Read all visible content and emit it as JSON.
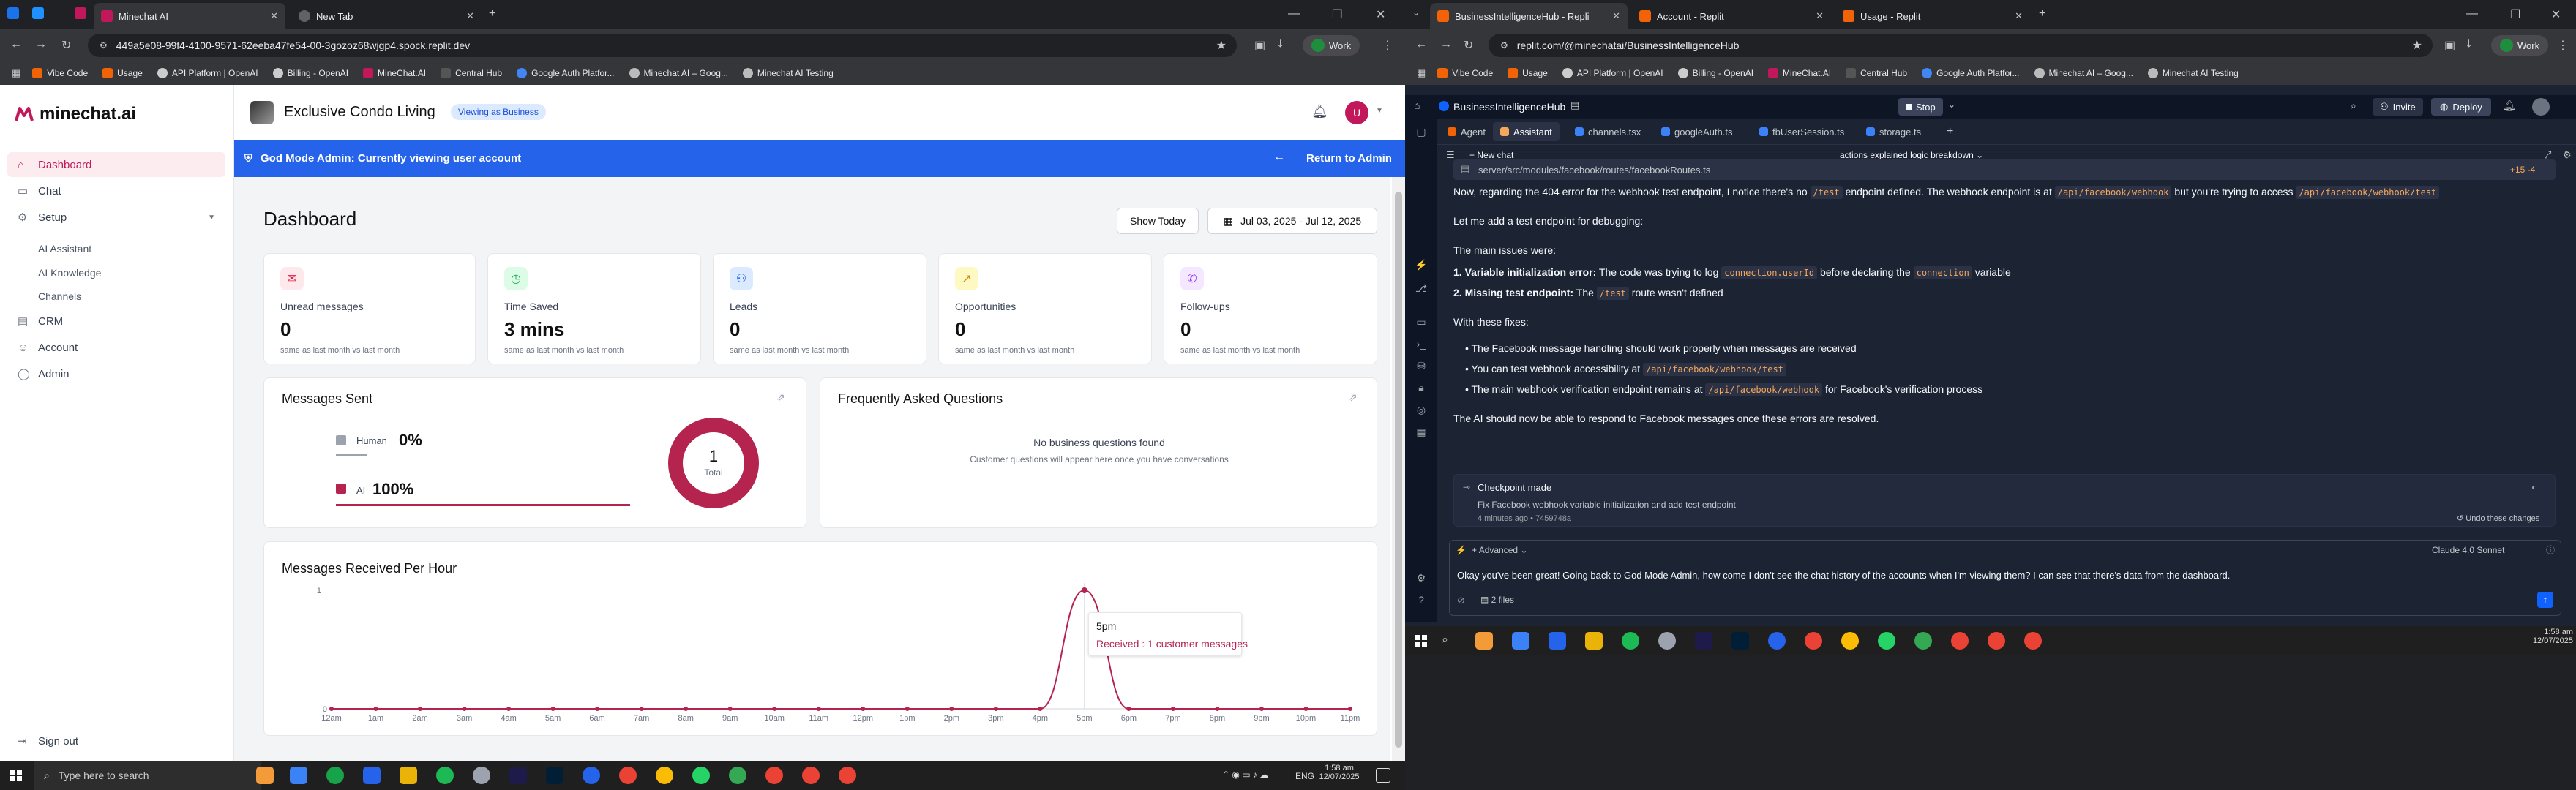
{
  "left_browser": {
    "tabs": [
      {
        "label": "Minechat AI",
        "active": true
      },
      {
        "label": "New Tab",
        "active": false
      }
    ],
    "url": "449a5e08-99f4-4100-9571-62eeba47fe54-00-3gozoz68wjgp4.spock.replit.dev",
    "profile": "Work",
    "bookmarks": [
      "Vibe Code",
      "Usage",
      "API Platform | OpenAI",
      "Billing - OpenAI",
      "MineChat.AI",
      "Central Hub",
      "Google Auth Platfor...",
      "Minechat AI – Goog...",
      "Minechat AI Testing"
    ]
  },
  "app": {
    "logo_text": "minechat.ai",
    "business_name": "Exclusive Condo Living",
    "viewing_badge": "Viewing as Business",
    "avatar_letter": "U",
    "banner_text": "God Mode Admin: Currently viewing user account",
    "banner_return": "Return to Admin",
    "sidebar": {
      "items": [
        {
          "label": "Dashboard",
          "selected": true
        },
        {
          "label": "Chat"
        },
        {
          "label": "Setup"
        },
        {
          "label": "AI Assistant"
        },
        {
          "label": "AI Knowledge"
        },
        {
          "label": "Channels"
        },
        {
          "label": "CRM"
        },
        {
          "label": "Account"
        },
        {
          "label": "Admin"
        }
      ],
      "signout": "Sign out"
    },
    "dashboard": {
      "title": "Dashboard",
      "show_today": "Show Today",
      "date_range": "Jul 03, 2025 - Jul 12, 2025",
      "stats": [
        {
          "label": "Unread messages",
          "value": "0",
          "sub": "same as last month vs last month",
          "icon": "mail-icon",
          "color": "#e11d48"
        },
        {
          "label": "Time Saved",
          "value": "3 mins",
          "sub": "same as last month vs last month",
          "icon": "clock-icon",
          "color": "#16a34a"
        },
        {
          "label": "Leads",
          "value": "0",
          "sub": "same as last month vs last month",
          "icon": "users-icon",
          "color": "#2563eb"
        },
        {
          "label": "Opportunities",
          "value": "0",
          "sub": "same as last month vs last month",
          "icon": "trend-icon",
          "color": "#ca8a04"
        },
        {
          "label": "Follow-ups",
          "value": "0",
          "sub": "same as last month vs last month",
          "icon": "phone-icon",
          "color": "#9333ea"
        }
      ],
      "messages_sent": {
        "title": "Messages Sent",
        "human_label": "Human",
        "human_value": "0%",
        "ai_label": "AI",
        "ai_value": "100%",
        "total_value": "1",
        "total_label": "Total"
      },
      "faq": {
        "title": "Frequently Asked Questions",
        "empty_title": "No business questions found",
        "empty_sub": "Customer questions will appear here once you have conversations"
      }
    }
  },
  "chart_data": {
    "type": "line",
    "title": "Messages Received Per Hour",
    "categories": [
      "12am",
      "1am",
      "2am",
      "3am",
      "4am",
      "5am",
      "6am",
      "7am",
      "8am",
      "9am",
      "10am",
      "11am",
      "12pm",
      "1pm",
      "2pm",
      "3pm",
      "4pm",
      "5pm",
      "6pm",
      "7pm",
      "8pm",
      "9pm",
      "10pm",
      "11pm"
    ],
    "values": [
      0,
      0,
      0,
      0,
      0,
      0,
      0,
      0,
      0,
      0,
      0,
      0,
      0,
      0,
      0,
      0,
      0,
      1,
      0,
      0,
      0,
      0,
      0,
      0
    ],
    "y_top_label": "1",
    "y_bottom_label": "0",
    "tooltip_title": "5pm",
    "tooltip_text": "Received : 1 customer messages",
    "color": "#b5234f"
  },
  "taskbar_left": {
    "search_placeholder": "Type here to search",
    "time": "1:58 am",
    "date": "12/07/2025",
    "lang": "ENG"
  },
  "right_browser": {
    "tabs": [
      {
        "label": "BusinessIntelligenceHub - Repli",
        "active": true
      },
      {
        "label": "Account - Replit",
        "active": false
      },
      {
        "label": "Usage - Replit",
        "active": false
      }
    ],
    "url": "replit.com/@minechatai/BusinessIntelligenceHub",
    "profile": "Work",
    "bookmarks": [
      "Vibe Code",
      "Usage",
      "API Platform | OpenAI",
      "Billing - OpenAI",
      "MineChat.AI",
      "Central Hub",
      "Google Auth Platfor...",
      "Minechat AI – Goog...",
      "Minechat AI Testing"
    ]
  },
  "replit": {
    "project": "BusinessIntelligenceHub",
    "stop": "Stop",
    "invite": "Invite",
    "deploy": "Deploy",
    "tabs": [
      "Agent",
      "Assistant",
      "channels.tsx",
      "googleAuth.ts",
      "fbUserSession.ts",
      "storage.ts"
    ],
    "new_chat": "New chat",
    "chat_title": "actions explained logic breakdown",
    "file_path": "server/src/modules/facebook/routes/facebookRoutes.ts",
    "file_diff": "+15 -4",
    "messages": {
      "p1_a": "Now, regarding the 404 error for the webhook test endpoint, I notice there's no ",
      "p1_c1": "/test",
      "p1_b": " endpoint defined. The webhook endpoint is at ",
      "p1_c2": "/api/facebook/webhook",
      "p1_c": " but you're trying to access ",
      "p1_c3": "/api/facebook/webhook/test",
      "p2": "Let me add a test endpoint for debugging:",
      "p3": "The main issues were:",
      "i1_b": "1. Variable initialization error:",
      "i1_a": " The code was trying to log ",
      "i1_c1": "connection.userId",
      "i1_m": " before declaring the ",
      "i1_c2": "connection",
      "i1_e": " variable",
      "i2_b": "2. Missing test endpoint:",
      "i2_a": " The ",
      "i2_c": "/test",
      "i2_e": " route wasn't defined",
      "p4": "With these fixes:",
      "b1": "The Facebook message handling should work properly when messages are received",
      "b2_a": "You can test webhook accessibility at ",
      "b2_c": "/api/facebook/webhook/test",
      "b3_a": "The main webhook verification endpoint remains at ",
      "b3_c": "/api/facebook/webhook",
      "b3_e": " for Facebook's verification process",
      "p5": "The AI should now be able to respond to Facebook messages once these errors are resolved."
    },
    "checkpoint": {
      "title": "Checkpoint made",
      "desc": "Fix Facebook webhook variable initialization and add test endpoint",
      "meta": "4 minutes ago • 7459748a",
      "undo": "Undo these changes"
    },
    "advanced": "Advanced",
    "model": "Claude 4.0 Sonnet",
    "input_text": "Okay you've been great! Going back to God Mode Admin, how come I don't see the chat history of the accounts when I'm viewing them? I can see that there's data from the dashboard.",
    "files": "2 files"
  },
  "taskbar_right": {
    "time": "1:58 am",
    "date": "12/07/2025"
  }
}
